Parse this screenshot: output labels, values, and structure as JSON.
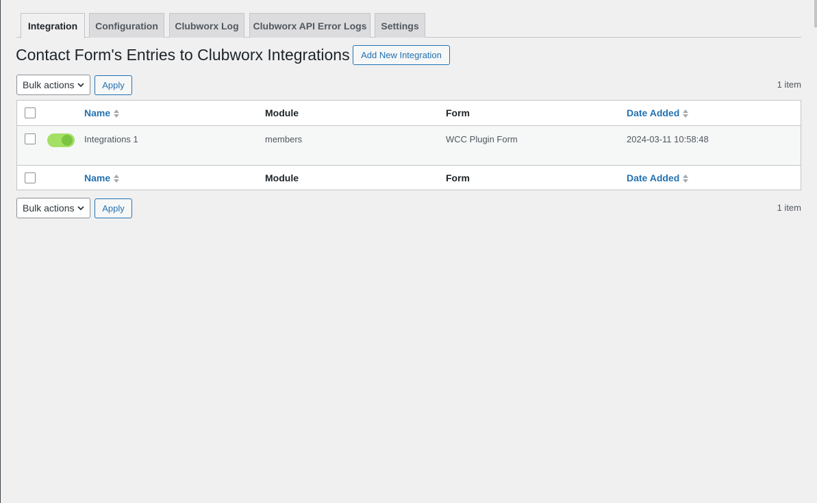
{
  "tabs": [
    {
      "label": "Integration",
      "active": true
    },
    {
      "label": "Configuration",
      "active": false
    },
    {
      "label": "Clubworx Log",
      "active": false
    },
    {
      "label": "Clubworx API Error Logs",
      "active": false
    },
    {
      "label": "Settings",
      "active": false
    }
  ],
  "page": {
    "title": "Contact Form's Entries to Clubworx Integrations",
    "add_button": "Add New Integration"
  },
  "bulk": {
    "select_label": "Bulk actions",
    "apply_label": "Apply",
    "count": "1 item"
  },
  "table": {
    "columns": {
      "name": "Name",
      "module": "Module",
      "form": "Form",
      "date_added": "Date Added"
    },
    "rows": [
      {
        "enabled": true,
        "name": "Integrations 1",
        "module": "members",
        "form": "WCC Plugin Form",
        "date_added": "2024-03-11 10:58:48"
      }
    ]
  },
  "colors": {
    "accent": "#2271b1",
    "toggle_on": "#a3e063",
    "toggle_knob": "#7cc542",
    "background": "#f0f0f1"
  },
  "icons": {
    "sort": "sort-arrows-icon",
    "dropdown": "chevron-down-icon"
  }
}
